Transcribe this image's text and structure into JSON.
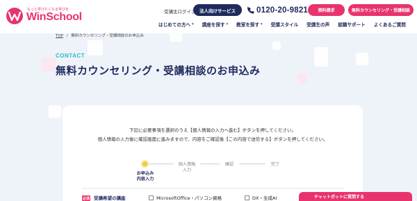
{
  "header": {
    "logo_tagline": "もっと学びたくなる学びを",
    "logo_text": "WinSchool",
    "login_link": "受講生ログイン",
    "corporate_button": "法人向けサービス",
    "phone_number": "0120-20-9821",
    "brochure_button": "資料請求",
    "counseling_button": "無料カウンセリング・受講相談",
    "nav": [
      {
        "label": "はじめての方へ",
        "has_caret": true
      },
      {
        "label": "講座を探す",
        "has_caret": true
      },
      {
        "label": "教室を探す",
        "has_caret": true
      },
      {
        "label": "受講スタイル",
        "has_caret": false
      },
      {
        "label": "受講生の声",
        "has_caret": false
      },
      {
        "label": "就職サポート",
        "has_caret": false
      },
      {
        "label": "よくあるご質問",
        "has_caret": false
      }
    ],
    "nav_caret": "▾"
  },
  "breadcrumb": {
    "home": "TOP",
    "separator": "/",
    "current": "無料カウンセリング・受講相談のお申込み"
  },
  "hero": {
    "label": "CONTACT",
    "title": "無料カウンセリング・受講相談のお申込み"
  },
  "form": {
    "intro_line1": "下記に必要事項を選択のうえ【個人情報の入力へ進む】ボタンを押してください。",
    "intro_line2": "個人情報の入力後に確認画面に進みますので、内容をご確認後【この内容で送信する】ボタンを押してください。",
    "steps": [
      {
        "label_line1": "お申込み",
        "label_line2": "内容入力",
        "active": true
      },
      {
        "label_line1": "個人情報",
        "label_line2": "入力",
        "active": false
      },
      {
        "label_line1": "確認",
        "label_line2": "",
        "active": false
      },
      {
        "label_line1": "完了",
        "label_line2": "",
        "active": false
      }
    ],
    "required_badge": "必須",
    "course_field_label": "受講希望の講座",
    "course_options": [
      {
        "label": "MicrosoftOffice・パソコン資格",
        "checked": false
      },
      {
        "label": "DX・生成AI",
        "checked": false
      }
    ]
  },
  "chatbot": {
    "label": "チャットボットに質問する"
  },
  "colors": {
    "brand_pink": "#e8336d",
    "navy": "#1f2a5c",
    "teal": "#2cbcc0",
    "step_active": "#f1cb3c",
    "hero_bg": "#eef3fa"
  }
}
